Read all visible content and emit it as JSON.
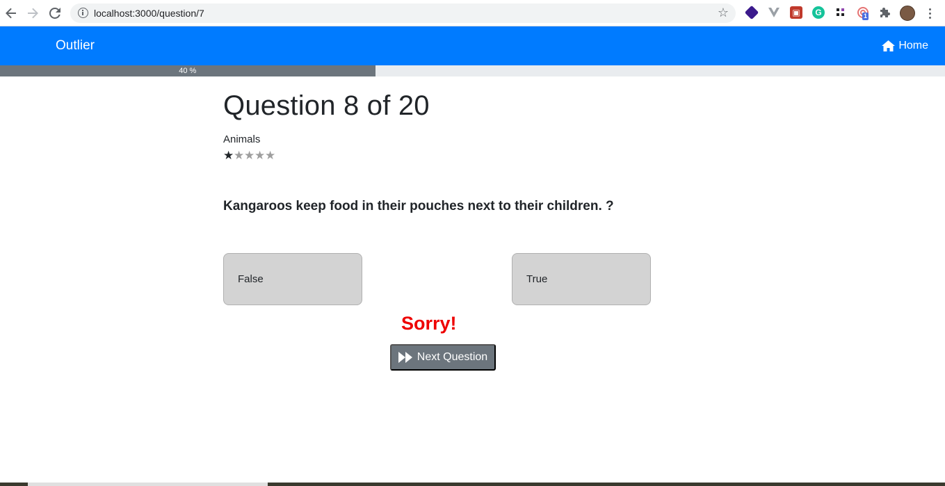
{
  "browser": {
    "url": "localhost:3000/question/7",
    "back_icon": "arrow-left-icon",
    "forward_icon": "arrow-right-icon",
    "reload_icon": "reload-icon",
    "extensions": [
      "cube-extension-icon",
      "vue-devtools-icon",
      "picture-extension-icon",
      "grammarly-icon",
      "grid-extension-icon",
      "target-extension-icon",
      "puzzle-icon"
    ],
    "badge_count": "1"
  },
  "navbar": {
    "brand": "Outlier",
    "home_label": "Home",
    "color": "#007bff"
  },
  "progress": {
    "percent": 40,
    "label": "40 %"
  },
  "question": {
    "title": "Question 8 of 20",
    "category": "Animals",
    "difficulty": {
      "filled": 1,
      "total": 5
    },
    "text": "Kangaroos keep food in their pouches next to their children. ?",
    "answers": [
      "False",
      "True"
    ],
    "feedback": "Sorry!",
    "feedback_color": "#ee0000",
    "next_label": "Next Question"
  }
}
